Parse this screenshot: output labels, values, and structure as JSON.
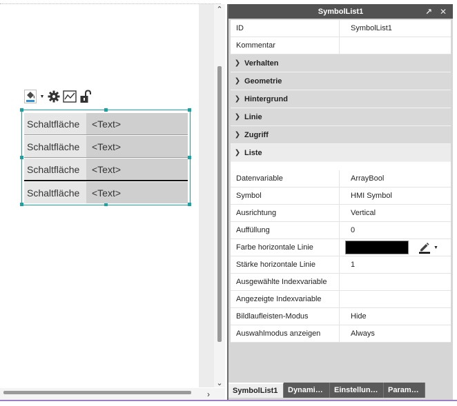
{
  "panel": {
    "title": "SymbolList1",
    "expand_icon": "expand-arrow-icon",
    "close_icon": "close-icon"
  },
  "properties": {
    "top_rows": [
      {
        "name": "ID",
        "value": "SymbolList1"
      },
      {
        "name": "Kommentar",
        "value": ""
      }
    ],
    "groups": [
      {
        "label": "Verhalten",
        "state": "collapsed"
      },
      {
        "label": "Geometrie",
        "state": "collapsed"
      },
      {
        "label": "Hintergrund",
        "state": "collapsed"
      },
      {
        "label": "Linie",
        "state": "collapsed"
      },
      {
        "label": "Zugriff",
        "state": "collapsed"
      }
    ],
    "open_group": {
      "label": "Liste",
      "rows": [
        {
          "name": "Datenvariable",
          "value": "ArrayBool"
        },
        {
          "name": "Symbol",
          "value": "HMI Symbol"
        },
        {
          "name": "Ausrichtung",
          "value": "Vertical"
        },
        {
          "name": "Auffüllung",
          "value": "0"
        },
        {
          "name": "Farbe horizontale Linie",
          "value": "",
          "color": "#000000"
        },
        {
          "name": "Stärke horizontale Linie",
          "value": "1"
        },
        {
          "name": "Ausgewählte Indexvariable",
          "value": ""
        },
        {
          "name": "Angezeigte Indexvariable",
          "value": ""
        },
        {
          "name": "Bildlaufleisten-Modus",
          "value": "Hide"
        },
        {
          "name": "Auswahlmodus anzeigen",
          "value": "Always"
        }
      ]
    }
  },
  "tabs": [
    {
      "label": "SymbolList1",
      "active": true
    },
    {
      "label": "Dynami…",
      "active": false
    },
    {
      "label": "Einstellun…",
      "active": false
    },
    {
      "label": "Param…",
      "active": false
    }
  ],
  "widget": {
    "rows": [
      {
        "button": "Schaltfläche",
        "text": "<Text>"
      },
      {
        "button": "Schaltfläche",
        "text": "<Text>"
      },
      {
        "button": "Schaltfläche",
        "text": "<Text>"
      },
      {
        "button": "Schaltfläche",
        "text": "<Text>"
      }
    ],
    "border_color": "#1aa3a3"
  },
  "toolbar": {
    "icons": [
      "paint-bucket-icon",
      "settings-gear-icon",
      "chart-icon",
      "unlock-icon"
    ]
  },
  "colors": {
    "panel_header": "#525252",
    "selection": "#1aa3a3",
    "accent_line": "#9980c4"
  }
}
